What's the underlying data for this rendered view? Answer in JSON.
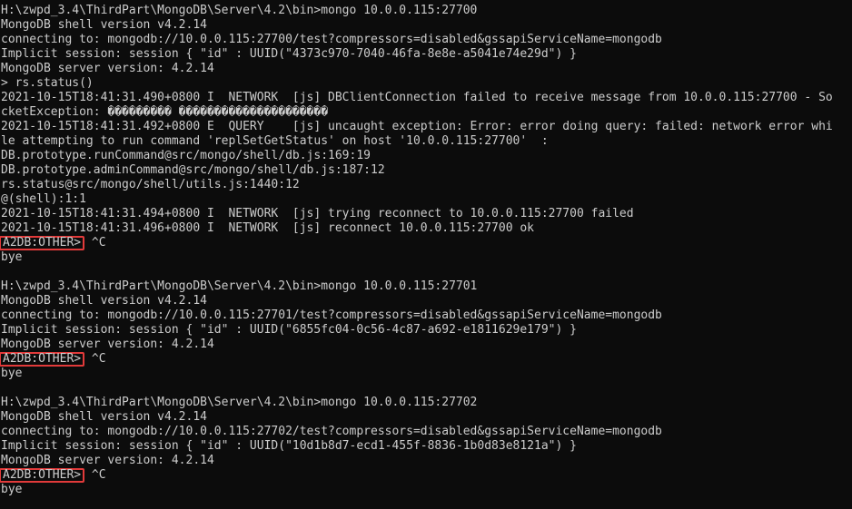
{
  "highlight_color": "#e23a3a",
  "terminal": {
    "sessions": [
      {
        "lines": [
          {
            "text": "H:\\zwpd_3.4\\ThirdPart\\MongoDB\\Server\\4.2\\bin>mongo 10.0.0.115:27700"
          },
          {
            "text": "MongoDB shell version v4.2.14"
          },
          {
            "text": "connecting to: mongodb://10.0.0.115:27700/test?compressors=disabled&gssapiServiceName=mongodb"
          },
          {
            "text": "Implicit session: session { \"id\" : UUID(\"4373c970-7040-46fa-8e8e-a5041e74e29d\") }"
          },
          {
            "text": "MongoDB server version: 4.2.14"
          },
          {
            "text": "> rs.status()"
          },
          {
            "text": "2021-10-15T18:41:31.490+0800 I  NETWORK  [js] DBClientConnection failed to receive message from 10.0.0.115:27700 - So"
          },
          {
            "text": "cketException: ��������� ���������������������"
          },
          {
            "text": "2021-10-15T18:41:31.492+0800 E  QUERY    [js] uncaught exception: Error: error doing query: failed: network error whi"
          },
          {
            "text": "le attempting to run command 'replSetGetStatus' on host '10.0.0.115:27700'  :"
          },
          {
            "text": "DB.prototype.runCommand@src/mongo/shell/db.js:169:19"
          },
          {
            "text": "DB.prototype.adminCommand@src/mongo/shell/db.js:187:12"
          },
          {
            "text": "rs.status@src/mongo/shell/utils.js:1440:12"
          },
          {
            "text": "@(shell):1:1"
          },
          {
            "text": "2021-10-15T18:41:31.494+0800 I  NETWORK  [js] trying reconnect to 10.0.0.115:27700 failed"
          },
          {
            "text": "2021-10-15T18:41:31.496+0800 I  NETWORK  [js] reconnect 10.0.0.115:27700 ok"
          }
        ],
        "prompt": "A2DB:OTHER>",
        "input": " ^C",
        "exit": "bye"
      },
      {
        "lines": [
          {
            "text": "H:\\zwpd_3.4\\ThirdPart\\MongoDB\\Server\\4.2\\bin>mongo 10.0.0.115:27701"
          },
          {
            "text": "MongoDB shell version v4.2.14"
          },
          {
            "text": "connecting to: mongodb://10.0.0.115:27701/test?compressors=disabled&gssapiServiceName=mongodb"
          },
          {
            "text": "Implicit session: session { \"id\" : UUID(\"6855fc04-0c56-4c87-a692-e1811629e179\") }"
          },
          {
            "text": "MongoDB server version: 4.2.14"
          }
        ],
        "prompt": "A2DB:OTHER>",
        "input": " ^C",
        "exit": "bye"
      },
      {
        "lines": [
          {
            "text": "H:\\zwpd_3.4\\ThirdPart\\MongoDB\\Server\\4.2\\bin>mongo 10.0.0.115:27702"
          },
          {
            "text": "MongoDB shell version v4.2.14"
          },
          {
            "text": "connecting to: mongodb://10.0.0.115:27702/test?compressors=disabled&gssapiServiceName=mongodb"
          },
          {
            "text": "Implicit session: session { \"id\" : UUID(\"10d1b8d7-ecd1-455f-8836-1b0d83e8121a\") }"
          },
          {
            "text": "MongoDB server version: 4.2.14"
          }
        ],
        "prompt": "A2DB:OTHER>",
        "input": " ^C",
        "exit": "bye"
      }
    ]
  }
}
